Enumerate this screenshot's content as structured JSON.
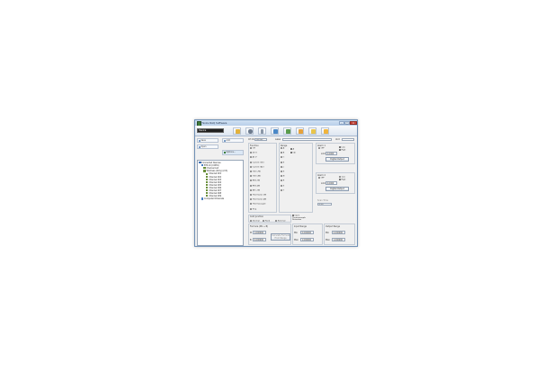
{
  "window": {
    "title": "Thinks DAQ Software"
  },
  "toolbar": {
    "device_combo": "Device"
  },
  "left": {
    "buttons": [
      "Save",
      "Add",
      "Open",
      "Options..."
    ]
  },
  "tree": {
    "nodes": [
      {
        "label": "Connected Devices",
        "level": 0
      },
      {
        "label": "BTS 10 (COM1)",
        "level": 1
      },
      {
        "label": "Channel List",
        "level": 2
      },
      {
        "label": "Windows (Only) (2ch)",
        "level": 2
      },
      {
        "label": "Channel 001",
        "level": 3
      },
      {
        "label": "Channel 002",
        "level": 3
      },
      {
        "label": "Channel 003",
        "level": 3
      },
      {
        "label": "Channel 004",
        "level": 3
      },
      {
        "label": "Channel 005",
        "level": 3
      },
      {
        "label": "Channel 006",
        "level": 3
      },
      {
        "label": "Channel 007",
        "level": 3
      },
      {
        "label": "Channel 008",
        "level": 3
      },
      {
        "label": "Channel 009",
        "level": 3
      },
      {
        "label": "Computed Channels",
        "level": 1
      }
    ]
  },
  "panel": {
    "top_row": {
      "channel_label": "CH ID",
      "channel_value": "CH 001",
      "name_label": "Label",
      "unit_label": "Unit"
    },
    "function": {
      "title": "Function",
      "options": [
        "Off",
        "DC V",
        "AC V",
        "Current (DC)",
        "Current (AC)",
        "Ohm 2W",
        "Ohm 4W",
        "RTD 2W",
        "RTD 4W",
        "NTC 2W",
        "Thermistor 2W",
        "Thermistor 4W",
        "Thermocouple",
        "Freq"
      ],
      "selected": 12
    },
    "range": {
      "title": "Range",
      "options": [
        "A",
        "B",
        "C",
        "E",
        "J",
        "K",
        "N",
        "R",
        "S",
        "T"
      ],
      "selected": 0
    },
    "extra_checks": [
      "A",
      "CJC"
    ],
    "alarm1": {
      "title": "Alarm 1",
      "off": "OFF",
      "low": "Low",
      "high": "High",
      "limit_label": "Limit",
      "limit_value": "0.0000",
      "button": "Digital Output"
    },
    "alarm2": {
      "title": "Alarm 2",
      "off": "OFF",
      "low": "Low",
      "high": "High",
      "limit_label": "Limit",
      "limit_value": "0.0000",
      "button": "Digital Output"
    },
    "scan_time": {
      "label": "Scan Time",
      "value": "0.00"
    },
    "cjc": {
      "title": "Cold Junction",
      "options": [
        "Internal",
        "Fixed",
        "External"
      ],
      "selected": 0
    },
    "open_tc": {
      "label": "Open Thermocouple Detection"
    },
    "formula": {
      "title": "Formula (Mx + B)",
      "m_label": "M",
      "m_value": "1.000000",
      "b_label": "B",
      "b_value": "0.000000",
      "button": "Calculate Formula From Range"
    },
    "input_range": {
      "title": "Input Range",
      "min_label": "Min",
      "min_value": "0.000000",
      "max_label": "Max",
      "max_value": "1.000000"
    },
    "output_range": {
      "title": "Output Range",
      "min_label": "Min",
      "min_value": "0.000000",
      "max_label": "Max",
      "max_value": "1.000000"
    }
  }
}
